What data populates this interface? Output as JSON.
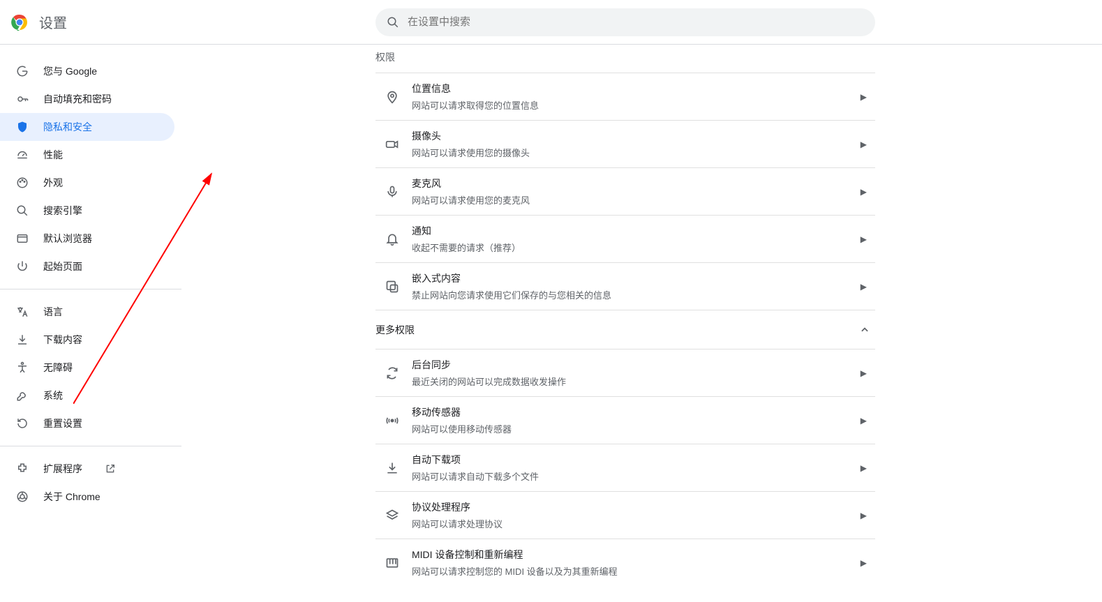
{
  "header": {
    "title": "设置"
  },
  "search": {
    "placeholder": "在设置中搜索"
  },
  "sidebar": {
    "group1": [
      {
        "label": "您与 Google",
        "name": "google"
      },
      {
        "label": "自动填充和密码",
        "name": "autofill"
      },
      {
        "label": "隐私和安全",
        "name": "privacy",
        "active": true
      },
      {
        "label": "性能",
        "name": "performance"
      },
      {
        "label": "外观",
        "name": "appearance"
      },
      {
        "label": "搜索引擎",
        "name": "search-engine"
      },
      {
        "label": "默认浏览器",
        "name": "default-browser"
      },
      {
        "label": "起始页面",
        "name": "on-startup"
      }
    ],
    "group2": [
      {
        "label": "语言",
        "name": "languages"
      },
      {
        "label": "下载内容",
        "name": "downloads"
      },
      {
        "label": "无障碍",
        "name": "accessibility"
      },
      {
        "label": "系统",
        "name": "system"
      },
      {
        "label": "重置设置",
        "name": "reset"
      }
    ],
    "group3": [
      {
        "label": "扩展程序",
        "name": "extensions",
        "external": true
      },
      {
        "label": "关于 Chrome",
        "name": "about"
      }
    ]
  },
  "sections": {
    "permissions_label": "权限",
    "more_permissions_label": "更多权限"
  },
  "rows": {
    "location": {
      "title": "位置信息",
      "sub": "网站可以请求取得您的位置信息"
    },
    "camera": {
      "title": "摄像头",
      "sub": "网站可以请求使用您的摄像头"
    },
    "mic": {
      "title": "麦克风",
      "sub": "网站可以请求使用您的麦克风"
    },
    "notifications": {
      "title": "通知",
      "sub": "收起不需要的请求（推荐）"
    },
    "embedded": {
      "title": "嵌入式内容",
      "sub": "禁止网站向您请求使用它们保存的与您相关的信息"
    },
    "background_sync": {
      "title": "后台同步",
      "sub": "最近关闭的网站可以完成数据收发操作"
    },
    "motion": {
      "title": "移动传感器",
      "sub": "网站可以使用移动传感器"
    },
    "auto_dl": {
      "title": "自动下载项",
      "sub": "网站可以请求自动下载多个文件"
    },
    "protocol": {
      "title": "协议处理程序",
      "sub": "网站可以请求处理协议"
    },
    "midi": {
      "title": "MIDI 设备控制和重新编程",
      "sub": "网站可以请求控制您的 MIDI 设备以及为其重新编程"
    }
  }
}
